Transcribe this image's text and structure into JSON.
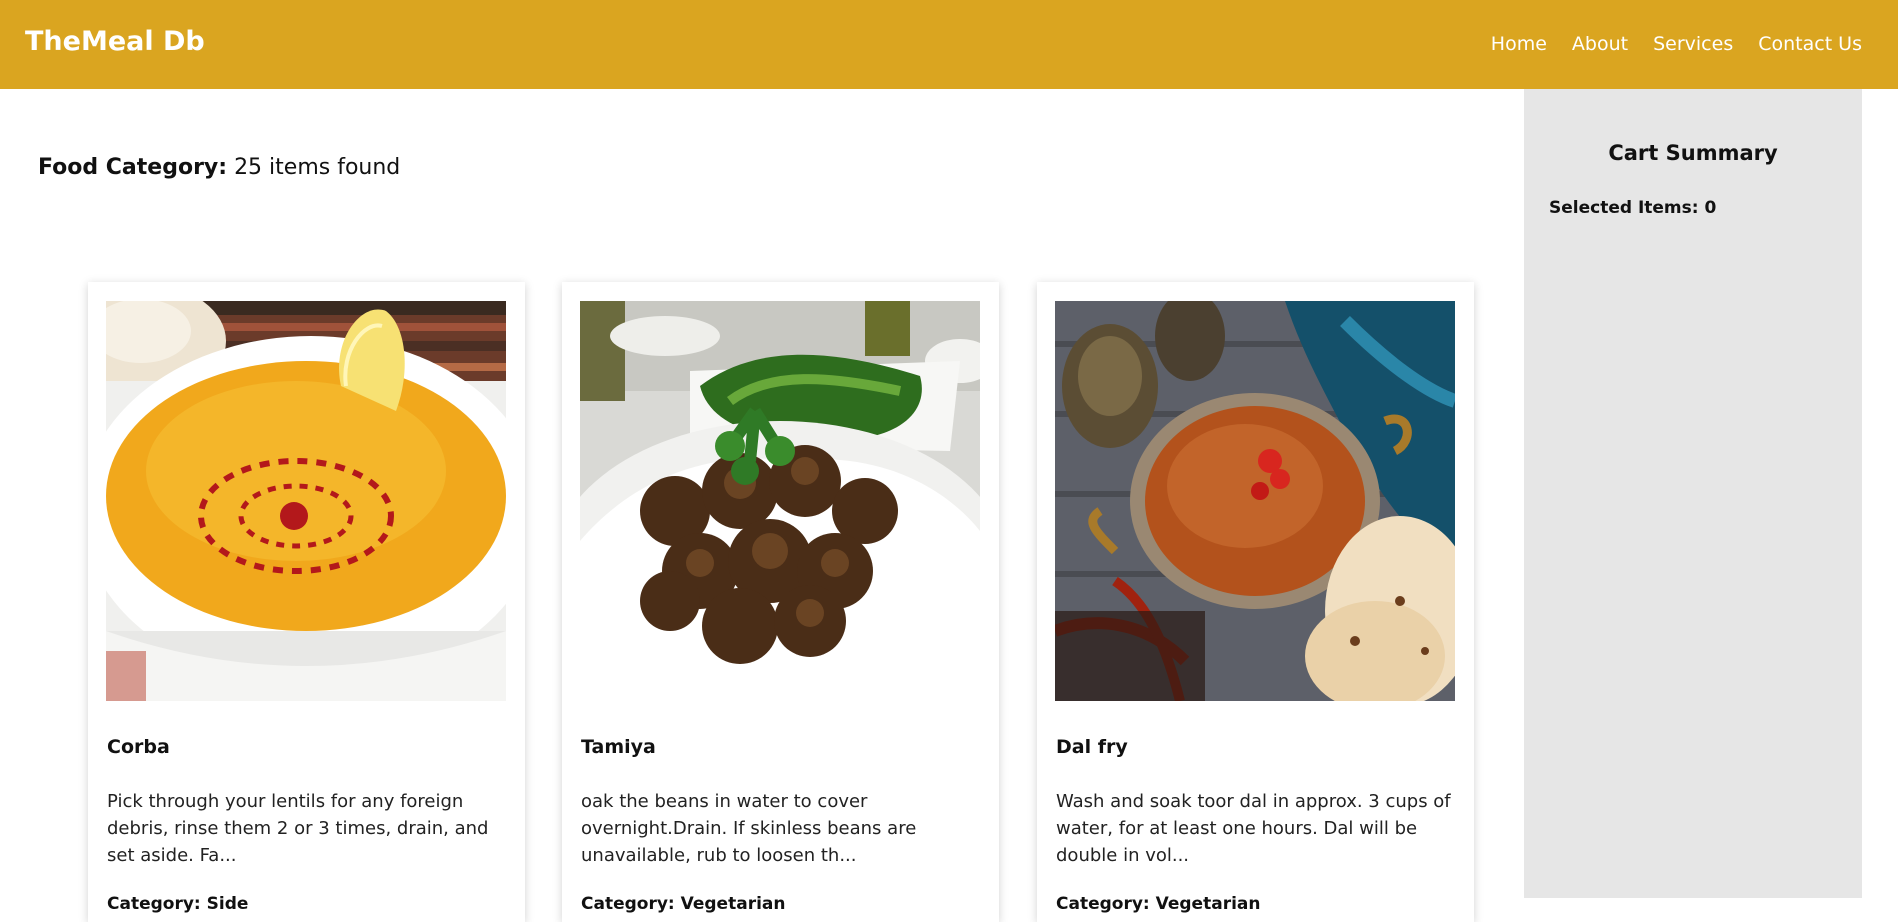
{
  "header": {
    "brand": "TheMeal Db",
    "nav": [
      "Home",
      "About",
      "Services",
      "Contact Us"
    ]
  },
  "main": {
    "heading_label": "Food Category:",
    "heading_count": "25 items found"
  },
  "cart": {
    "title": "Cart Summary",
    "selected": "Selected Items: 0"
  },
  "meals": [
    {
      "name": "Corba",
      "description": "Pick through your lentils for any foreign debris, rinse them 2 or 3 times, drain, and set aside. Fa...",
      "category": "Category: Side"
    },
    {
      "name": "Tamiya",
      "description": "oak the beans in water to cover overnight.Drain. If skinless beans are unavailable, rub to loosen th...",
      "category": "Category: Vegetarian"
    },
    {
      "name": "Dal fry",
      "description": "Wash and soak toor dal in approx. 3 cups of water, for at least one hours. Dal will be double in vol...",
      "category": "Category: Vegetarian"
    }
  ],
  "colors": {
    "header": "#daa520",
    "sidebar": "#e6e6e6"
  }
}
